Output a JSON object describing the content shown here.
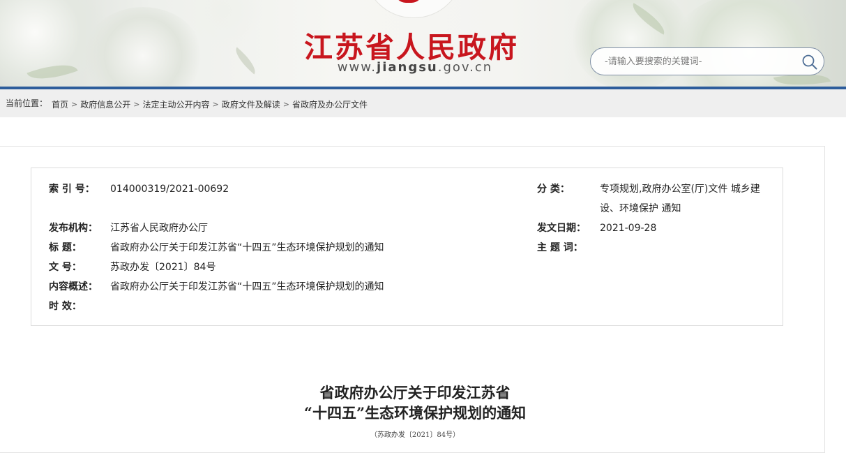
{
  "header": {
    "site_title": "江苏省人民政府",
    "site_url_prefix": "www.",
    "site_url_domain": "jiangsu",
    "site_url_suffix": ".gov.cn",
    "brand_color": "#c8161e",
    "search": {
      "placeholder": "-请输入要搜索的关键词-",
      "icon": "search-icon"
    }
  },
  "breadcrumb": {
    "label": "当前位置：",
    "items": [
      "首页",
      "政府信息公开",
      "法定主动公开内容",
      "政府文件及解读",
      "省政府及办公厅文件"
    ],
    "separator": ">"
  },
  "meta": {
    "index_label": "索 引 号：",
    "index_value": "014000319/2021-00692",
    "category_label": "分 类：",
    "category_value_line1": "专项规划,政府办公室(厅)文件 城乡建",
    "category_value_line2": "设、环境保护 通知",
    "issuer_label": "发布机构：",
    "issuer_value": "江苏省人民政府办公厅",
    "date_label": "发文日期：",
    "date_value": "2021-09-28",
    "title_label": "标 题：",
    "title_value": "省政府办公厅关于印发江苏省“十四五”生态环境保护规划的通知",
    "subject_label": "主 题 词：",
    "subject_value": "",
    "docno_label": "文 号：",
    "docno_value": "苏政办发〔2021〕84号",
    "summary_label": "内容概述：",
    "summary_value": "省政府办公厅关于印发江苏省“十四五”生态环境保护规划的通知",
    "validity_label": "时 效：",
    "validity_value": ""
  },
  "document": {
    "title_line1": "省政府办公厅关于印发江苏省",
    "title_line2": "“十四五”生态环境保护规划的通知",
    "doc_number": "（苏政办发〔2021〕84号）"
  }
}
